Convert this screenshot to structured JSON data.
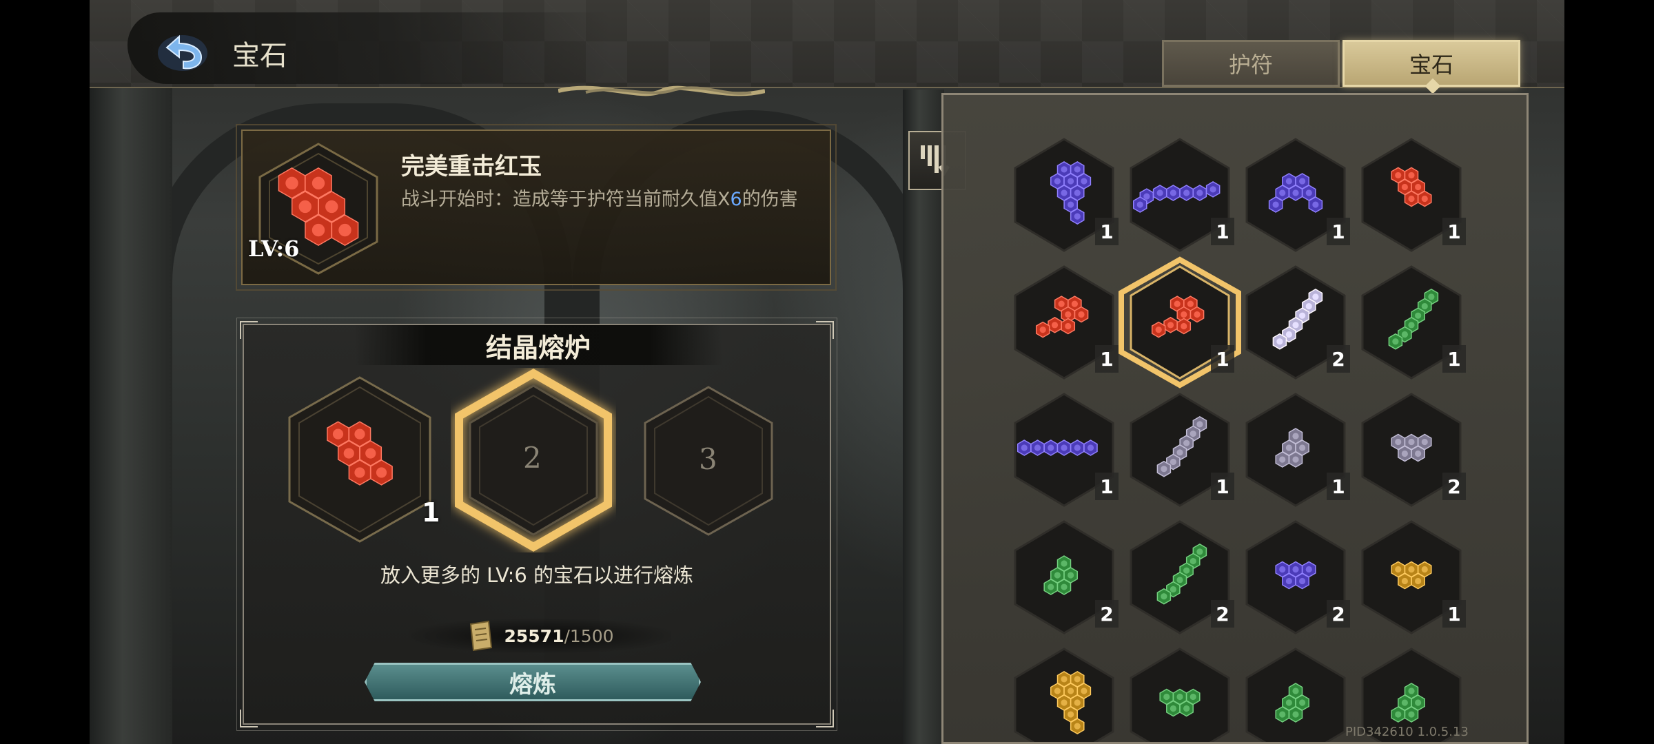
{
  "header": {
    "title": "宝石"
  },
  "tabs": [
    {
      "label": "护符",
      "active": false
    },
    {
      "label": "宝石",
      "active": true
    }
  ],
  "selected_gem": {
    "name": "完美重击红玉",
    "level": "LV:6",
    "desc_prefix": "战斗开始时：造成等于护符当前耐久值X",
    "desc_highlight": "6",
    "desc_suffix": "的伤害",
    "color": "#c83a22"
  },
  "furnace": {
    "title": "结晶熔炉",
    "slots": [
      {
        "index": "1",
        "filled": true,
        "count": "1",
        "color": "red",
        "shape": "diag"
      },
      {
        "index": "2",
        "filled": false,
        "highlight": true
      },
      {
        "index": "3",
        "filled": false
      }
    ],
    "hint": "放入更多的 LV:6 的宝石以进行熔炼",
    "cost_have": "25571",
    "cost_need": "/1500",
    "smelt_label": "熔炼"
  },
  "inventory": [
    {
      "color": "purple",
      "shape": "tall",
      "count": "1"
    },
    {
      "color": "purple",
      "shape": "line",
      "count": "1"
    },
    {
      "color": "purple",
      "shape": "arch",
      "count": "1"
    },
    {
      "color": "red",
      "shape": "diag",
      "count": "1"
    },
    {
      "color": "red",
      "shape": "blob",
      "count": "1"
    },
    {
      "color": "red",
      "shape": "blob",
      "count": "1",
      "selected": true
    },
    {
      "color": "lavender",
      "shape": "rise",
      "count": "2"
    },
    {
      "color": "green",
      "shape": "rise",
      "count": "1"
    },
    {
      "color": "purple",
      "shape": "hline",
      "count": "1"
    },
    {
      "color": "grey",
      "shape": "rise",
      "count": "1"
    },
    {
      "color": "grey",
      "shape": "cluster",
      "count": "1"
    },
    {
      "color": "grey",
      "shape": "tri",
      "count": "2"
    },
    {
      "color": "green",
      "shape": "cluster",
      "count": "2"
    },
    {
      "color": "green",
      "shape": "rise",
      "count": "2"
    },
    {
      "color": "purple",
      "shape": "tri",
      "count": "2"
    },
    {
      "color": "gold",
      "shape": "tri",
      "count": "1"
    },
    {
      "color": "gold",
      "shape": "tall",
      "count": ""
    },
    {
      "color": "green",
      "shape": "tri",
      "count": ""
    },
    {
      "color": "green",
      "shape": "cluster",
      "count": ""
    },
    {
      "color": "green",
      "shape": "cluster",
      "count": ""
    }
  ],
  "gem_colors": {
    "purple": "#4b3bb8",
    "red": "#c8331c",
    "green": "#2f8a3a",
    "gold": "#b88418",
    "grey": "#7d7890",
    "lavender": "#b9b3d8"
  },
  "pid": "PID342610  1.0.5.13"
}
